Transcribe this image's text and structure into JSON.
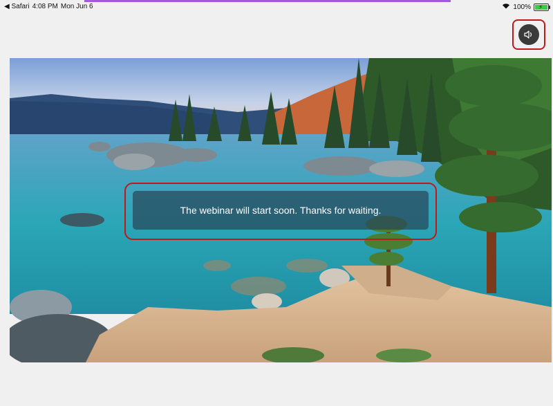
{
  "status_bar": {
    "back_app": "Safari",
    "time": "4:08 PM",
    "date": "Mon Jun 6",
    "battery_percent": "100%",
    "battery_level": 1.0,
    "charging": true
  },
  "audio_button": {
    "icon": "speaker-icon"
  },
  "background": {
    "scene": "lake-shore-landscape"
  },
  "waiting_message": "The webinar will start soon. Thanks for waiting.",
  "colors": {
    "highlight_outline": "#c0171b",
    "progress_line": "#a25ad9",
    "page_bg": "#f0f0f0"
  }
}
